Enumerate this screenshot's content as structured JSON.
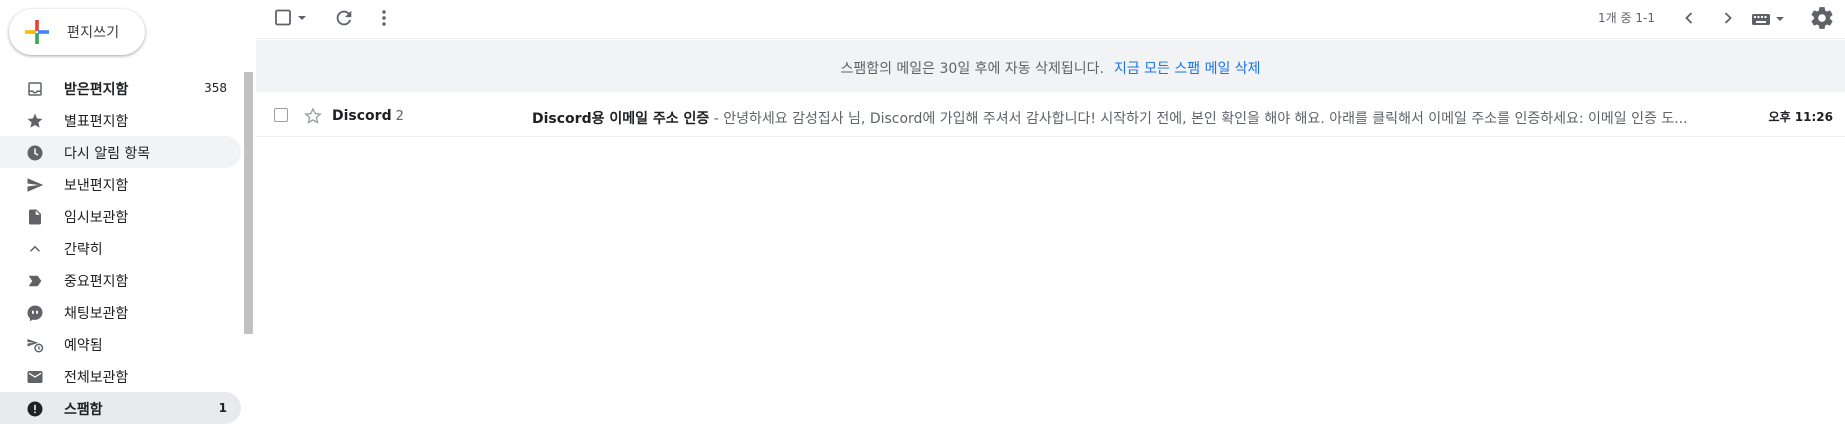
{
  "compose": {
    "label": "편지쓰기"
  },
  "sidebar": {
    "items": [
      {
        "label": "받은편지함",
        "count": "358",
        "icon": "inbox-icon"
      },
      {
        "label": "별표편지함",
        "count": "",
        "icon": "star-icon"
      },
      {
        "label": "다시 알림 항목",
        "count": "",
        "icon": "clock-icon"
      },
      {
        "label": "보낸편지함",
        "count": "",
        "icon": "send-icon"
      },
      {
        "label": "임시보관함",
        "count": "",
        "icon": "draft-icon"
      },
      {
        "label": "간략히",
        "count": "",
        "icon": "chevron-up-icon"
      },
      {
        "label": "중요편지함",
        "count": "",
        "icon": "label-important-icon"
      },
      {
        "label": "채팅보관함",
        "count": "",
        "icon": "chat-icon"
      },
      {
        "label": "예약됨",
        "count": "",
        "icon": "scheduled-icon"
      },
      {
        "label": "전체보관함",
        "count": "",
        "icon": "mail-icon"
      },
      {
        "label": "스팸함",
        "count": "1",
        "icon": "spam-icon"
      }
    ]
  },
  "toolbar": {
    "pager": "1개 중 1-1"
  },
  "banner": {
    "text": "스팸함의 메일은 30일 후에 자동 삭제됩니다.",
    "link": "지금 모든 스팸 메일 삭제"
  },
  "emails": [
    {
      "sender": "Discord",
      "thread_count": "2",
      "subject": "Discord용 이메일 주소 인증",
      "snippet": " - 안녕하세요 감성집사 님, Discord에 가입해 주셔서 감사합니다! 시작하기 전에, 본인 확인을 해야 해요. 아래를 클릭해서 이메일 주소를 인증하세요: 이메일 인증 도...",
      "time": "오후 11:26"
    }
  ],
  "colors": {
    "link": "#1a73e8",
    "banner_bg": "#f1f3f4",
    "active_bg": "#e8eaed"
  }
}
